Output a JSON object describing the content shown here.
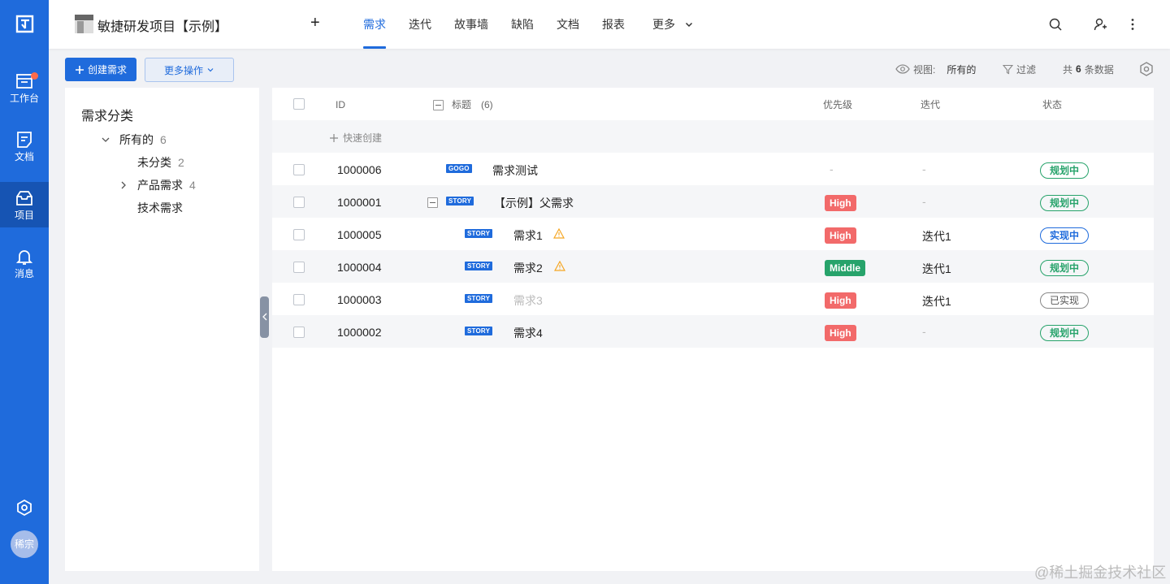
{
  "nav": {
    "items": [
      {
        "label": "工作台",
        "icon": "workbench-icon"
      },
      {
        "label": "文档",
        "icon": "doc-icon"
      },
      {
        "label": "项目",
        "icon": "project-icon"
      },
      {
        "label": "消息",
        "icon": "bell-icon"
      }
    ],
    "avatar": "稀宗"
  },
  "header": {
    "project_title": "敏捷研发项目【示例】",
    "plus": "+",
    "tabs": [
      "需求",
      "迭代",
      "故事墙",
      "缺陷",
      "文档",
      "报表",
      "更多"
    ],
    "active_tab": "需求"
  },
  "toolbar": {
    "create_label": "创建需求",
    "more_actions_label": "更多操作",
    "view_label": "视图:",
    "view_value": "所有的",
    "filter_label": "过滤",
    "count_prefix": "共",
    "count_value": "6",
    "count_suffix": "条数据"
  },
  "tree": {
    "title": "需求分类",
    "root": {
      "label": "所有的",
      "count": "6"
    },
    "children": [
      {
        "label": "未分类",
        "count": "2"
      },
      {
        "label": "产品需求",
        "count": "4"
      },
      {
        "label": "技术需求",
        "count": ""
      }
    ]
  },
  "table": {
    "headers": {
      "id": "ID",
      "title": "标题",
      "title_count": "(6)",
      "priority": "优先级",
      "iteration": "迭代",
      "status": "状态"
    },
    "quick_create": "快速创建",
    "rows": [
      {
        "id": "1000006",
        "tag": "GOGO",
        "title": "需求测试",
        "priority": "-",
        "iteration": "-",
        "status": "规划中"
      },
      {
        "id": "1000001",
        "tag": "STORY",
        "title": "【示例】父需求",
        "priority": "High",
        "iteration": "-",
        "status": "规划中"
      },
      {
        "id": "1000005",
        "tag": "STORY",
        "title": "需求1",
        "priority": "High",
        "iteration": "迭代1",
        "status": "实现中"
      },
      {
        "id": "1000004",
        "tag": "STORY",
        "title": "需求2",
        "priority": "Middle",
        "iteration": "迭代1",
        "status": "规划中"
      },
      {
        "id": "1000003",
        "tag": "STORY",
        "title": "需求3",
        "priority": "High",
        "iteration": "迭代1",
        "status": "已实现"
      },
      {
        "id": "1000002",
        "tag": "STORY",
        "title": "需求4",
        "priority": "High",
        "iteration": "-",
        "status": "规划中"
      }
    ]
  },
  "colors": {
    "brand": "#1f6bdc",
    "high": "#f26a6a",
    "middle": "#27a36b"
  },
  "watermark": "@稀土掘金技术社区"
}
